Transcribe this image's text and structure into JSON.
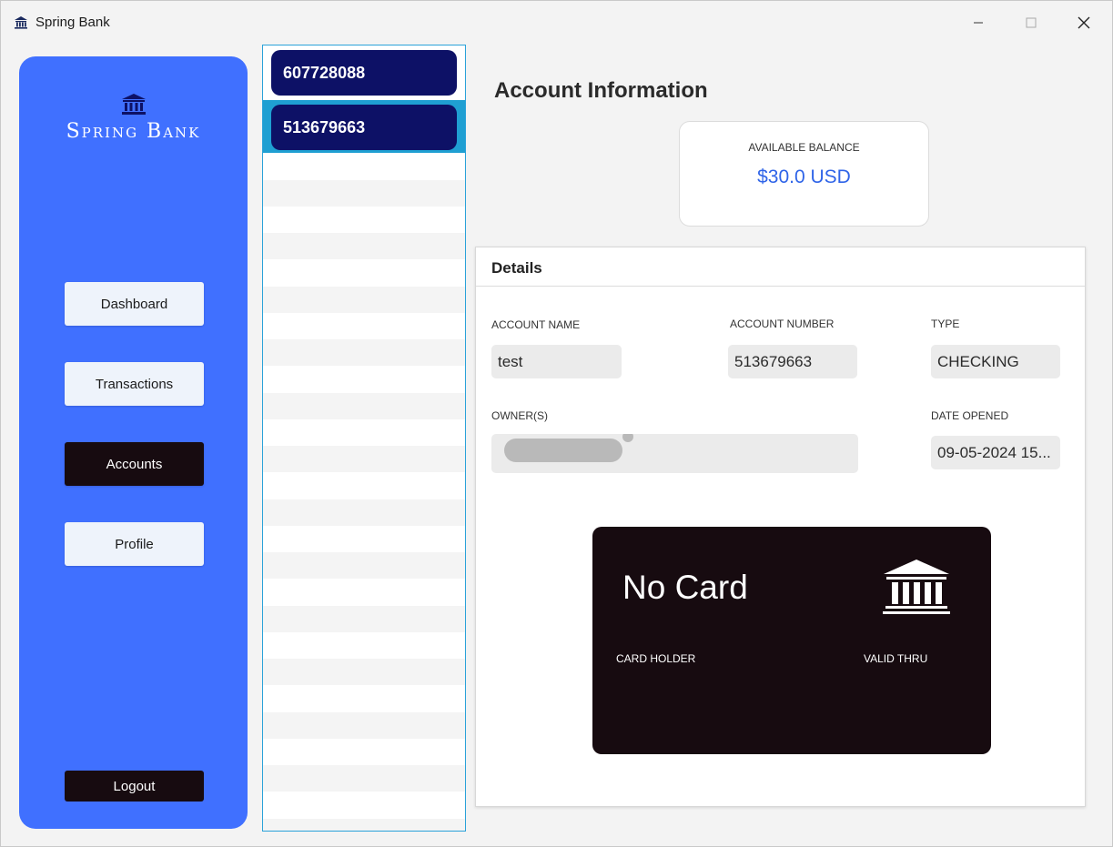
{
  "window": {
    "title": "Spring Bank",
    "controls": {
      "minimize": "minimize",
      "maximize": "maximize",
      "close": "close"
    }
  },
  "sidebar": {
    "logo_text": "Spring Bank",
    "nav": [
      {
        "label": "Dashboard"
      },
      {
        "label": "Transactions"
      },
      {
        "label": "Accounts",
        "active": true
      },
      {
        "label": "Profile"
      }
    ],
    "logout_label": "Logout"
  },
  "accounts": {
    "items": [
      {
        "number": "607728088"
      },
      {
        "number": "513679663",
        "selected": true
      }
    ]
  },
  "main": {
    "title": "Account Information",
    "balance": {
      "label": "AVAILABLE BALANCE",
      "value": "$30.0 USD"
    },
    "details": {
      "heading": "Details",
      "account_name": {
        "label": "ACCOUNT NAME",
        "value": "test"
      },
      "account_number": {
        "label": "ACCOUNT NUMBER",
        "value": "513679663"
      },
      "type": {
        "label": "TYPE",
        "value": "CHECKING"
      },
      "owners": {
        "label": "OWNER(S)",
        "value": ""
      },
      "date_opened": {
        "label": "DATE OPENED",
        "value": "09-05-2024 15..."
      }
    },
    "card": {
      "title": "No Card",
      "holder_label": "CARD HOLDER",
      "valid_label": "VALID THRU"
    }
  },
  "colors": {
    "sidebar": "#4070ff",
    "active_nav": "#170b10",
    "account_chip": "#0d1166",
    "selection": "#1f9fd2",
    "balance_text": "#2f64e8",
    "card": "#170b10"
  }
}
